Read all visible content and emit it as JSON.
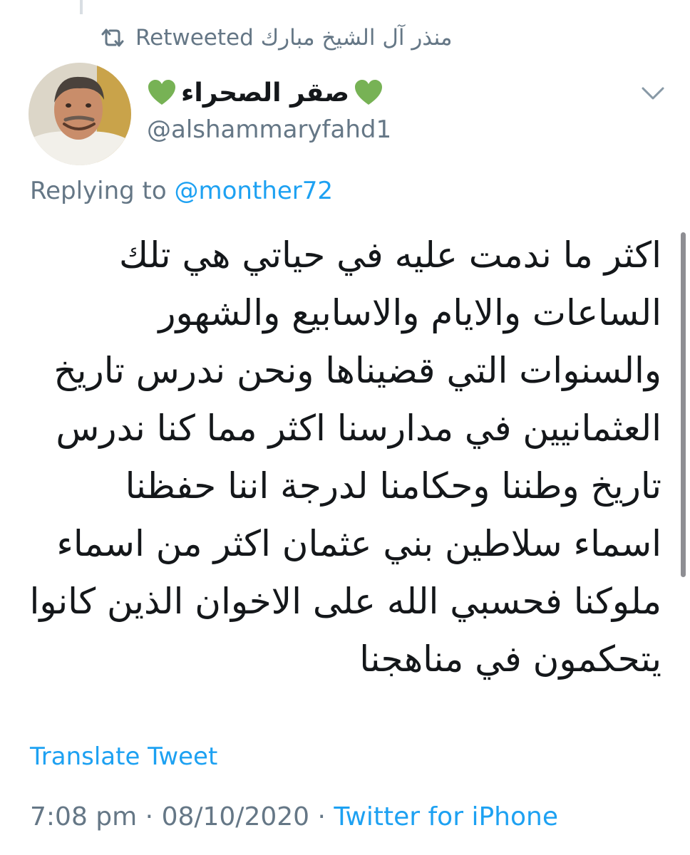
{
  "retweet_banner": {
    "icon": "retweet-icon",
    "text": "منذر آل الشيخ مبارك Retweeted"
  },
  "author": {
    "avatar": "profile-photo",
    "display_name": "صقر الصحراء",
    "emoji_left": "💚",
    "emoji_right": "💚",
    "handle": "@alshammaryfahd1"
  },
  "menu": {
    "icon": "chevron-down-icon"
  },
  "reply": {
    "prefix": "Replying to",
    "mention": "@monther72"
  },
  "tweet": {
    "lines": [
      "اكثر ما ندمت عليه في حياتي هي تلك",
      "الساعات والايام والاسابيع والشهور",
      "والسنوات التي قضيناها ونحن ندرس تاريخ",
      "العثمانيين في مدارسنا اكثر مما كنا ندرس",
      "تاريخ وطننا وحكامنا لدرجة اننا حفظنا",
      "اسماء سلاطين بني عثمان اكثر من اسماء",
      "ملوكنا فحسبي الله على الاخوان الذين كانوا",
      "يتحكمون في مناهجنا"
    ]
  },
  "translate_label": "Translate Tweet",
  "meta": {
    "time": "7:08 pm",
    "separator_1": " · ",
    "date": "08/10/2020",
    "separator_2": " · ",
    "source": "Twitter for iPhone"
  },
  "colors": {
    "text": "#14171a",
    "secondary": "#657786",
    "link": "#1da1f2",
    "heart": "#77b255"
  }
}
